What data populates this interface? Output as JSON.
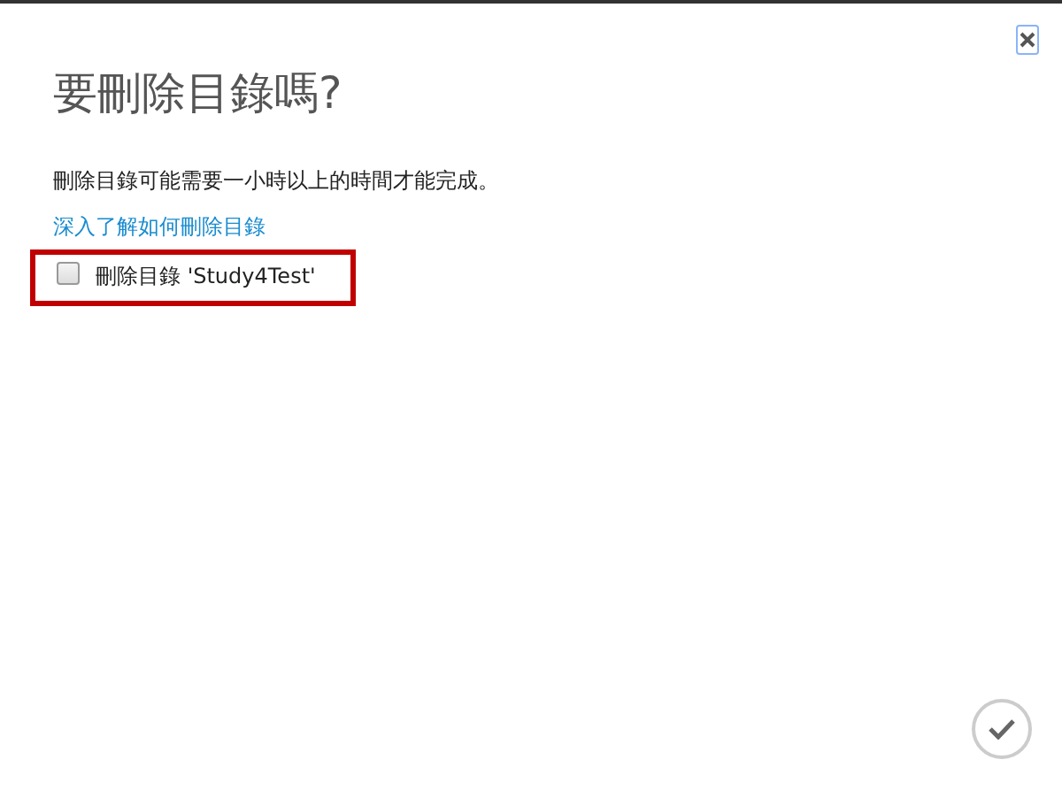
{
  "dialog": {
    "title": "要刪除目錄嗎?",
    "message": "刪除目錄可能需要一小時以上的時間才能完成。",
    "link": "深入了解如何刪除目錄",
    "checkbox": {
      "label": "刪除目錄 'Study4Test'",
      "checked": false,
      "highlighted": true
    }
  }
}
